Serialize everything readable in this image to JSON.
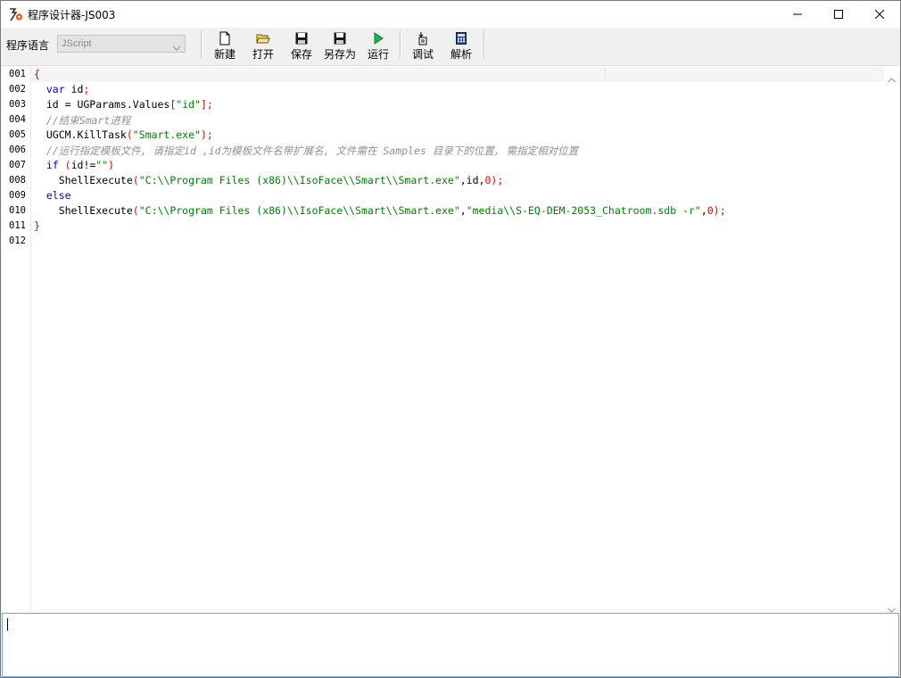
{
  "window": {
    "title": "程序设计器-JS003"
  },
  "toolbar": {
    "language_label": "程序语言",
    "language_value": "JScript",
    "buttons": [
      {
        "label": "新建",
        "icon": "new-file-icon"
      },
      {
        "label": "打开",
        "icon": "open-folder-icon"
      },
      {
        "label": "保存",
        "icon": "save-icon"
      },
      {
        "label": "另存为",
        "icon": "save-as-icon"
      },
      {
        "label": "运行",
        "icon": "run-icon"
      },
      {
        "label": "调试",
        "icon": "debug-icon"
      },
      {
        "label": "解析",
        "icon": "calculator-icon"
      }
    ]
  },
  "editor": {
    "line_numbers": [
      "001",
      "002",
      "003",
      "004",
      "005",
      "006",
      "007",
      "008",
      "009",
      "010",
      "011",
      "012"
    ],
    "lines": [
      "{",
      "  var id;",
      "  id = UGParams.Values[\"id\"];",
      "  //结束Smart进程",
      "  UGCM.KillTask(\"Smart.exe\");",
      "  //运行指定模板文件, 请指定id ,id为模板文件名带扩展名, 文件需在 Samples 目录下的位置, 需指定相对位置",
      "  if (id!=\"\")",
      "    ShellExecute(\"C:\\\\Program Files (x86)\\\\IsoFace\\\\Smart\\\\Smart.exe\",id,0);",
      "  else",
      "    ShellExecute(\"C:\\\\Program Files (x86)\\\\IsoFace\\\\Smart\\\\Smart.exe\",\"media\\\\S-EQ-DEM-2053_Chatroom.sdb -r\",0);",
      "}",
      ""
    ],
    "colors": {
      "keyword": "#0000c0",
      "string": "#008000",
      "comment": "#909090",
      "brace": "#e00000"
    }
  },
  "output": {
    "value": ""
  }
}
